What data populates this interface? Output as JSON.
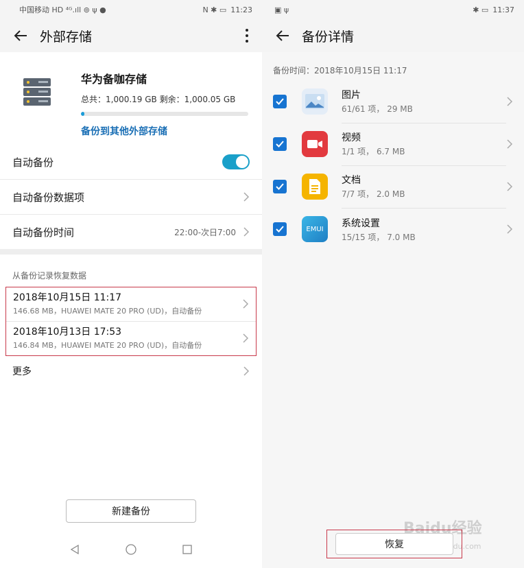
{
  "left": {
    "status": {
      "carrier": "中国移动 HD ⁴ᴳ.ıll ⊚ ψ ●",
      "right_icons": "N ✱ ▭",
      "time": "11:23"
    },
    "title": "外部存储",
    "storage": {
      "name": "华为备咖存储",
      "capacity": "总共：1,000.19 GB  剩余：1,000.05 GB",
      "used_fraction": 0.02,
      "backup_link": "备份到其他外部存储"
    },
    "auto_backup_label": "自动备份",
    "auto_backup_on": true,
    "auto_backup_items_label": "自动备份数据项",
    "auto_backup_time_label": "自动备份时间",
    "auto_backup_time_value": "22:00-次日7:00",
    "restore_section_title": "从备份记录恢复数据",
    "records": [
      {
        "date": "2018年10月15日 11:17",
        "detail": "146.68 MB，HUAWEI MATE 20 PRO (UD)，自动备份"
      },
      {
        "date": "2018年10月13日 17:53",
        "detail": "146.84 MB，HUAWEI MATE 20 PRO (UD)，自动备份"
      }
    ],
    "more_label": "更多",
    "new_backup_button": "新建备份"
  },
  "right": {
    "status": {
      "left_icons": "▣ ψ",
      "right_icons": "✱ ▭",
      "time": "11:37"
    },
    "title": "备份详情",
    "backup_time": "备份时间：2018年10月15日 11:17",
    "items": [
      {
        "name": "图片",
        "meta": "61/61 项， 29 MB",
        "icon": "gallery-icon",
        "color": "#dfe9f5"
      },
      {
        "name": "视频",
        "meta": "1/1 项， 6.7 MB",
        "icon": "video-icon",
        "color": "#e23a3f"
      },
      {
        "name": "文档",
        "meta": "7/7 项， 2.0 MB",
        "icon": "document-icon",
        "color": "#f5b400"
      },
      {
        "name": "系统设置",
        "meta": "15/15 项， 7.0 MB",
        "icon": "emui-icon",
        "color": "#2fa3dc"
      }
    ],
    "emui_text": "EMUI",
    "restore_button": "恢复"
  },
  "watermark": {
    "brand": "Baidu经验",
    "url": "jingyan.baidu.com"
  }
}
